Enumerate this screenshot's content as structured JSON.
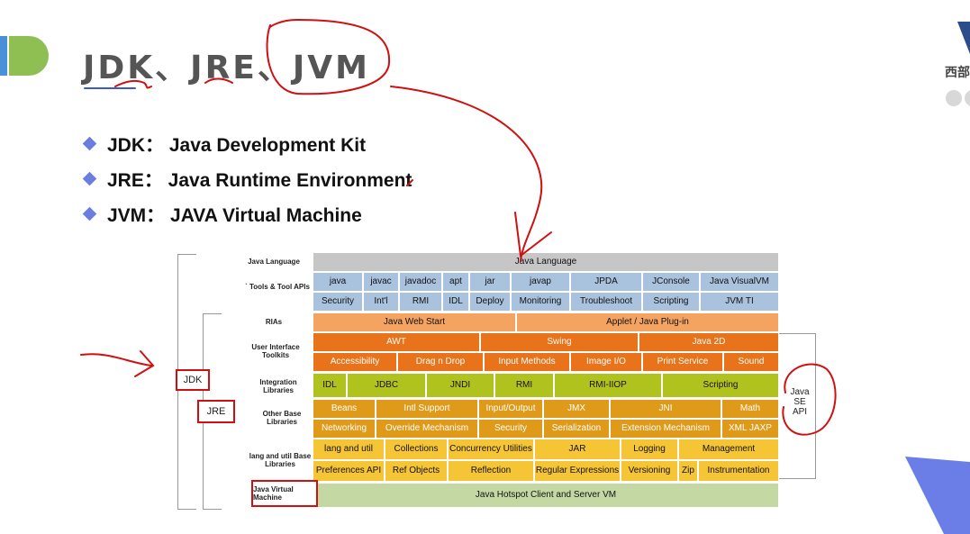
{
  "title": "JDK、JRE、JVM",
  "logo_text": "西部",
  "bullets": [
    {
      "label": "JDK：  Java Development Kit"
    },
    {
      "label": "JRE：  Java Runtime Environment"
    },
    {
      "label": "JVM：  JAVA Virtual Machine"
    }
  ],
  "diagram": {
    "row_labels": {
      "java_language": "Java Language",
      "tools": "` Tools & Tool APIs",
      "rias": "RIAs",
      "ui_toolkits": "User Interface Toolkits",
      "integration": "Integration Libraries",
      "other_base": "Other Base Libraries",
      "lang_util": "lang and util Base Libraries",
      "jvm": "Java Virtual Machine"
    },
    "java_language": "Java Language",
    "tools_row1": [
      "java",
      "javac",
      "javadoc",
      "apt",
      "jar",
      "javap",
      "JPDA",
      "JConsole",
      "Java VisualVM"
    ],
    "tools_row2": [
      "Security",
      "Int'l",
      "RMI",
      "IDL",
      "Deploy",
      "Monitoring",
      "Troubleshoot",
      "Scripting",
      "JVM TI"
    ],
    "rias": [
      "Java Web Start",
      "Applet / Java Plug-in"
    ],
    "ui_row1": [
      "AWT",
      "Swing",
      "Java 2D"
    ],
    "ui_row2": [
      "Accessibility",
      "Drag n Drop",
      "Input Methods",
      "Image I/O",
      "Print Service",
      "Sound"
    ],
    "integration": [
      "IDL",
      "JDBC",
      "JNDI",
      "RMI",
      "RMI-IIOP",
      "Scripting"
    ],
    "other_row1": [
      "Beans",
      "Intl Support",
      "Input/Output",
      "JMX",
      "JNI",
      "Math"
    ],
    "other_row2": [
      "Networking",
      "Override Mechanism",
      "Security",
      "Serialization",
      "Extension Mechanism",
      "XML JAXP"
    ],
    "lang_row1": [
      "lang and util",
      "Collections",
      "Concurrency Utilities",
      "JAR",
      "Logging",
      "Management"
    ],
    "lang_row2": [
      "Preferences API",
      "Ref Objects",
      "Reflection",
      "Regular Expressions",
      "Versioning",
      "Zip",
      "Instrumentation"
    ],
    "jvm": "Java Hotspot Client and Server VM",
    "annotations": {
      "jdk": "JDK",
      "jre": "JRE",
      "java_se_api": "Java SE API"
    }
  }
}
